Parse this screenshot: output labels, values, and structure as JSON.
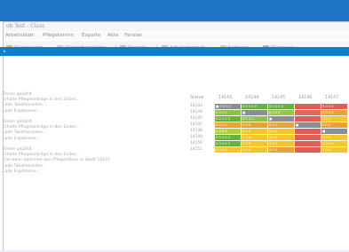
{
  "window": {
    "title": "ob Test - Class"
  },
  "menubar": {
    "items": [
      "Arbeitsblatt",
      "Pflegetermin",
      "Exporte",
      "Akte",
      "Fenster"
    ]
  },
  "toolbar": {
    "items": [
      {
        "label": "Rückgängig",
        "icon": "undo-icon"
      },
      {
        "label": "Wiederherstellen",
        "icon": "redo-icon"
      },
      {
        "label": "Reports",
        "icon": "report-icon"
      },
      {
        "label": "Arbeitsbereich",
        "icon": "workspace-icon"
      },
      {
        "label": "Settings",
        "icon": "settings-icon"
      },
      {
        "label": "Diagnose",
        "icon": "diagnose-icon"
      }
    ]
  },
  "log": {
    "lines": [
      "Zeilen gezählt",
      "Erhalte Pflegeeinträge in den Zeilen...",
      "Lade Tabellenzeilen...",
      "Lade Ergebnisse...",
      "",
      "Zeilen gezählt",
      "Erhalte Pflegeeinträge in den Zeilen...",
      "Lade Tabellenzeilen...",
      "Lade Ergebnisse...",
      "",
      "Zeilen gezählt",
      "Erhalte Pflegeeinträge in den Zeilen...",
      "Hier kann zwischen den Pflegesätzen in Stadt 14147",
      "Lade Tabellenzeilen...",
      "Lade Ergebnisse..."
    ]
  },
  "matrix": {
    "header_first": "Status",
    "columns": [
      "14143",
      "14144",
      "14145",
      "14146",
      "14147",
      "14148"
    ],
    "rows": [
      {
        "label": "14143",
        "cells": [
          {
            "text": "■ 0 0 0 0",
            "color": "#8a8f97"
          },
          {
            "text": "0 0 0 0 0",
            "color": "#67b23b"
          },
          {
            "text": "0 0 0 0 0",
            "color": "#67b23b"
          },
          {
            "text": "",
            "color": "#e05c55"
          },
          {
            "text": "0 0 0 0",
            "color": "#e05c55"
          }
        ]
      },
      {
        "label": "14144",
        "cells": [
          {
            "text": "0 0 0 0",
            "color": "#8fc04a"
          },
          {
            "text": "■",
            "color": "#8a8f97"
          },
          {
            "text": "0 0 0 0",
            "color": "#9cc44c"
          },
          {
            "text": "",
            "color": "#e5675f"
          },
          {
            "text": "0 0 0 0",
            "color": "#e9a13a"
          }
        ]
      },
      {
        "label": "14145",
        "cells": [
          {
            "text": "0 0 0 0 0",
            "color": "#67b23b"
          },
          {
            "text": "0 0 0 0",
            "color": "#8fc04a"
          },
          {
            "text": "■",
            "color": "#8a8f97"
          },
          {
            "text": "",
            "color": "#e05c55"
          },
          {
            "text": "0 0 0",
            "color": "#f0c62a"
          }
        ]
      },
      {
        "label": "14147",
        "cells": [
          {
            "text": "0 0 0 0",
            "color": "#e9a13a"
          },
          {
            "text": "0 0 0",
            "color": "#e9a13a"
          },
          {
            "text": "0 0 0",
            "color": "#e9a13a"
          },
          {
            "text": "■",
            "color": "#8a8f97"
          },
          {
            "text": "0 0 0",
            "color": "#e9a13a"
          }
        ]
      },
      {
        "label": "14148",
        "cells": [
          {
            "text": "0 0 0 0",
            "color": "#b5cf3c"
          },
          {
            "text": "0 0 0",
            "color": "#f0c62a"
          },
          {
            "text": "0 0 0",
            "color": "#f0c62a"
          },
          {
            "text": "",
            "color": "#e05c55"
          },
          {
            "text": "■",
            "color": "#8a8f97"
          }
        ]
      },
      {
        "label": "14149",
        "cells": [
          {
            "text": "0 0 0 0 0",
            "color": "#67b23b"
          },
          {
            "text": "0 0 0",
            "color": "#f0c62a"
          },
          {
            "text": "0 0 0",
            "color": "#f0c62a"
          },
          {
            "text": "",
            "color": "#e05c55"
          },
          {
            "text": "0 0 0",
            "color": "#f0c62a"
          }
        ]
      },
      {
        "label": "14150",
        "cells": [
          {
            "text": "0 0 0 0 0",
            "color": "#67b23b"
          },
          {
            "text": "0 0 0",
            "color": "#f0c62a"
          },
          {
            "text": "0 0 0",
            "color": "#f0c62a"
          },
          {
            "text": "",
            "color": "#e05c55"
          },
          {
            "text": "0 0 0 0",
            "color": "#f0c62a"
          }
        ]
      },
      {
        "label": "14151",
        "cells": [
          {
            "text": "0 0 0 0",
            "color": "#f0c62a"
          },
          {
            "text": "0 0 0",
            "color": "#f0c62a"
          },
          {
            "text": "0 0 0",
            "color": "#e9a13a"
          },
          {
            "text": "",
            "color": "#e05c55"
          },
          {
            "text": "0 0 0",
            "color": "#f0c62a"
          }
        ]
      }
    ]
  },
  "colors": {
    "topbar": "#1e74c6",
    "accent_band": "#0a7fd1"
  }
}
